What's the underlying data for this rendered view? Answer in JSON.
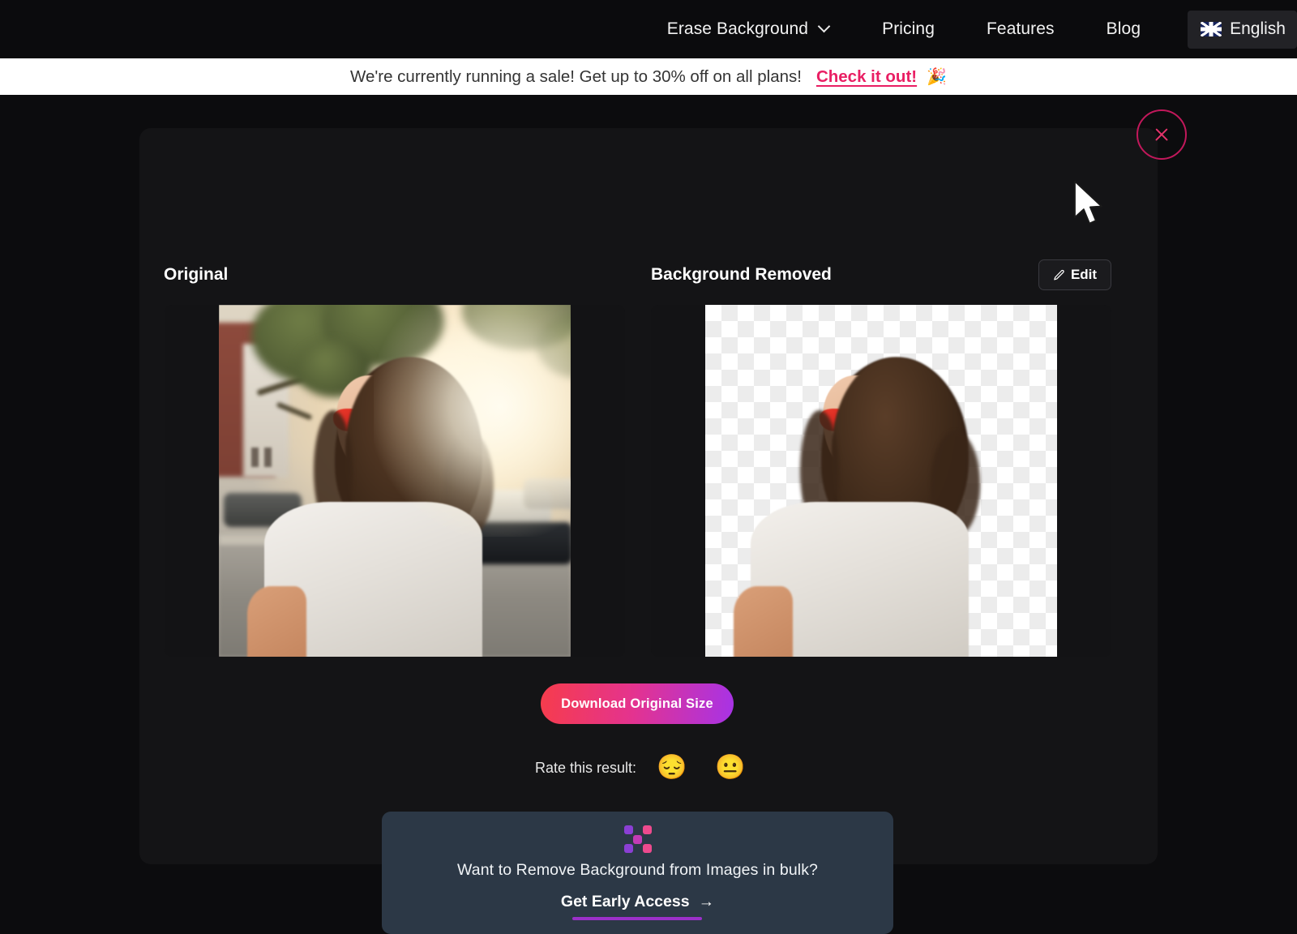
{
  "nav": {
    "items": [
      {
        "label": "Erase Background",
        "has_dropdown": true
      },
      {
        "label": "Pricing",
        "has_dropdown": false
      },
      {
        "label": "Features",
        "has_dropdown": false
      },
      {
        "label": "Blog",
        "has_dropdown": false
      }
    ],
    "language": {
      "label": "English",
      "flag": "uk-flag-icon"
    }
  },
  "banner": {
    "text": "We're currently running a sale! Get up to 30% off on all plans!",
    "cta": "Check it out!",
    "emoji": "🎉",
    "background": "#ffffff",
    "cta_color": "#e91e63"
  },
  "result": {
    "close_label": "close-icon",
    "panels": {
      "original_label": "Original",
      "removed_label": "Background Removed"
    },
    "edit_button": {
      "label": "Edit",
      "icon": "pencil-icon"
    },
    "download_button": {
      "label": "Download Original Size",
      "gradient_from": "#f63c4c",
      "gradient_to": "#a733e6"
    },
    "rating": {
      "label": "Rate this result:",
      "options": [
        {
          "name": "pensive-face-emoji",
          "glyph": "😔"
        },
        {
          "name": "neutral-face-emoji",
          "glyph": "😐"
        }
      ]
    },
    "bulk_promo": {
      "icon": "bulk-squares-icon",
      "title": "Want to Remove Background from Images in bulk?",
      "link": "Get Early Access",
      "arrow": "→",
      "background": "#2c3846",
      "underline_color": "#9b30c9"
    }
  }
}
